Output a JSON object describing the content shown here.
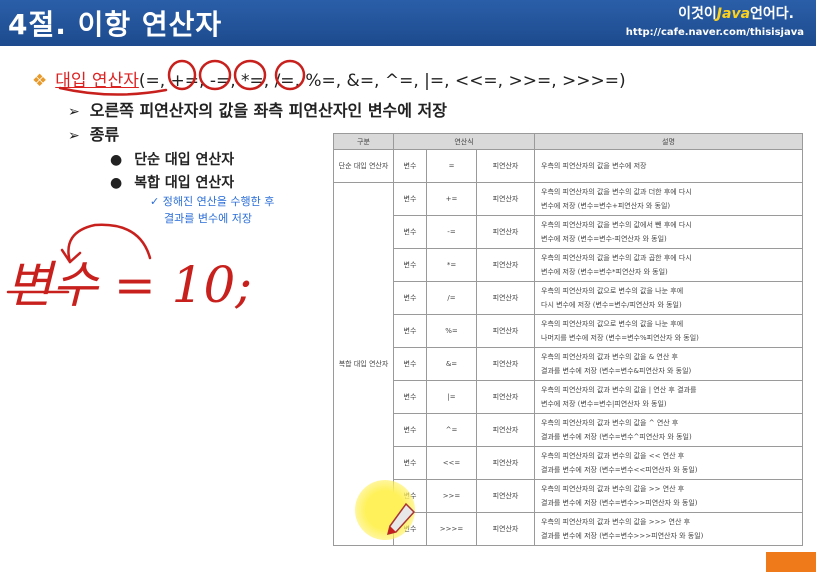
{
  "header": {
    "title": "4절. 이항 연산자",
    "brand_prefix": "이것이",
    "brand_java": "Java",
    "brand_suffix": "언어다.",
    "url": "http://cafe.naver.com/thisisjava"
  },
  "content": {
    "bullet_symbol": "❖",
    "assign_term": "대입 연산자",
    "assign_ops": "(=, +=, -=, *=, /=, %=, &=, ^=, |=, <<=, >>=, >>>=)",
    "sub1_arrow": "➢",
    "sub1": "오른쪽 피연산자의 값을 좌측 피연산자인 변수에 저장",
    "sub2_arrow": "➢",
    "sub2": "종류",
    "dot1": "단순 대입 연산자",
    "dot2": "복합 대입 연산자",
    "note_line1": "✓ 정해진 연산을 수행한 후",
    "note_line2": "결과를 변수에 저장"
  },
  "handwriting": {
    "text": "변수 = 10;",
    "color": "#c8201c"
  },
  "table": {
    "headers": [
      "구분",
      "연산식",
      "설명"
    ],
    "group_simple": "단순 대입 연산자",
    "group_compound": "복합 대입 연산자",
    "rows": [
      {
        "var": "변수",
        "op": "=",
        "operand": "피연산자",
        "desc1": "우측의 피연산자의 값을 변수에 저장",
        "desc2": ""
      },
      {
        "var": "변수",
        "op": "+=",
        "operand": "피연산자",
        "desc1": "우측의 피연산자의 값을 변수의 값과 더한 후에 다시",
        "desc2": "변수에 저장 (변수=변수+피연산자 와 동일)"
      },
      {
        "var": "변수",
        "op": "-=",
        "operand": "피연산자",
        "desc1": "우측의 피연산자의 값을 변수의 값에서 뺀 후에 다시",
        "desc2": "변수에 저장 (변수=변수-피연산자 와 동일)"
      },
      {
        "var": "변수",
        "op": "*=",
        "operand": "피연산자",
        "desc1": "우측의 피연산자의 값을 변수의 값과 곱한 후에 다시",
        "desc2": "변수에 저장 (변수=변수*피연산자 와 동일)"
      },
      {
        "var": "변수",
        "op": "/=",
        "operand": "피연산자",
        "desc1": "우측의 피연산자의 값으로 변수의 값을 나눈 후에",
        "desc2": "다시 변수에 저장 (변수=변수/피연산자 와 동일)"
      },
      {
        "var": "변수",
        "op": "%=",
        "operand": "피연산자",
        "desc1": "우측의 피연산자의 값으로 변수의 값을 나눈 후에",
        "desc2": "나머지를 변수에 저장 (변수=변수%피연산자 와 동일)"
      },
      {
        "var": "변수",
        "op": "&=",
        "operand": "피연산자",
        "desc1": "우측의 피연산자의 값과 변수의 값을 & 연산 후",
        "desc2": "결과를 변수에 저장 (변수=변수&피연산자 와 동일)"
      },
      {
        "var": "변수",
        "op": "|=",
        "operand": "피연산자",
        "desc1": "우측의 피연산자의 값과 변수의 값을 | 연산 후 결과를",
        "desc2": "변수에 저장 (변수=변수|피연산자 와 동일)"
      },
      {
        "var": "변수",
        "op": "^=",
        "operand": "피연산자",
        "desc1": "우측의 피연산자의 값과 변수의 값을 ^ 연산 후",
        "desc2": "결과를 변수에 저장 (변수=변수^피연산자 와 동일)"
      },
      {
        "var": "변수",
        "op": "<<=",
        "operand": "피연산자",
        "desc1": "우측의 피연산자의 값과 변수의 값을 << 연산 후",
        "desc2": "결과를 변수에 저장 (변수=변수<<피연산자 와 동일)"
      },
      {
        "var": "변수",
        "op": ">>=",
        "operand": "피연산자",
        "desc1": "우측의 피연산자의 값과 변수의 값을 >> 연산 후",
        "desc2": "결과를 변수에 저장 (변수=변수>>피연산자 와 동일)"
      },
      {
        "var": "변수",
        "op": ">>>=",
        "operand": "피연산자",
        "desc1": "우측의 피연산자의 값과 변수의 값을 >>> 연산 후",
        "desc2": "결과를 변수에 저장 (변수=변수>>>피연산자 와 동일)"
      }
    ]
  }
}
